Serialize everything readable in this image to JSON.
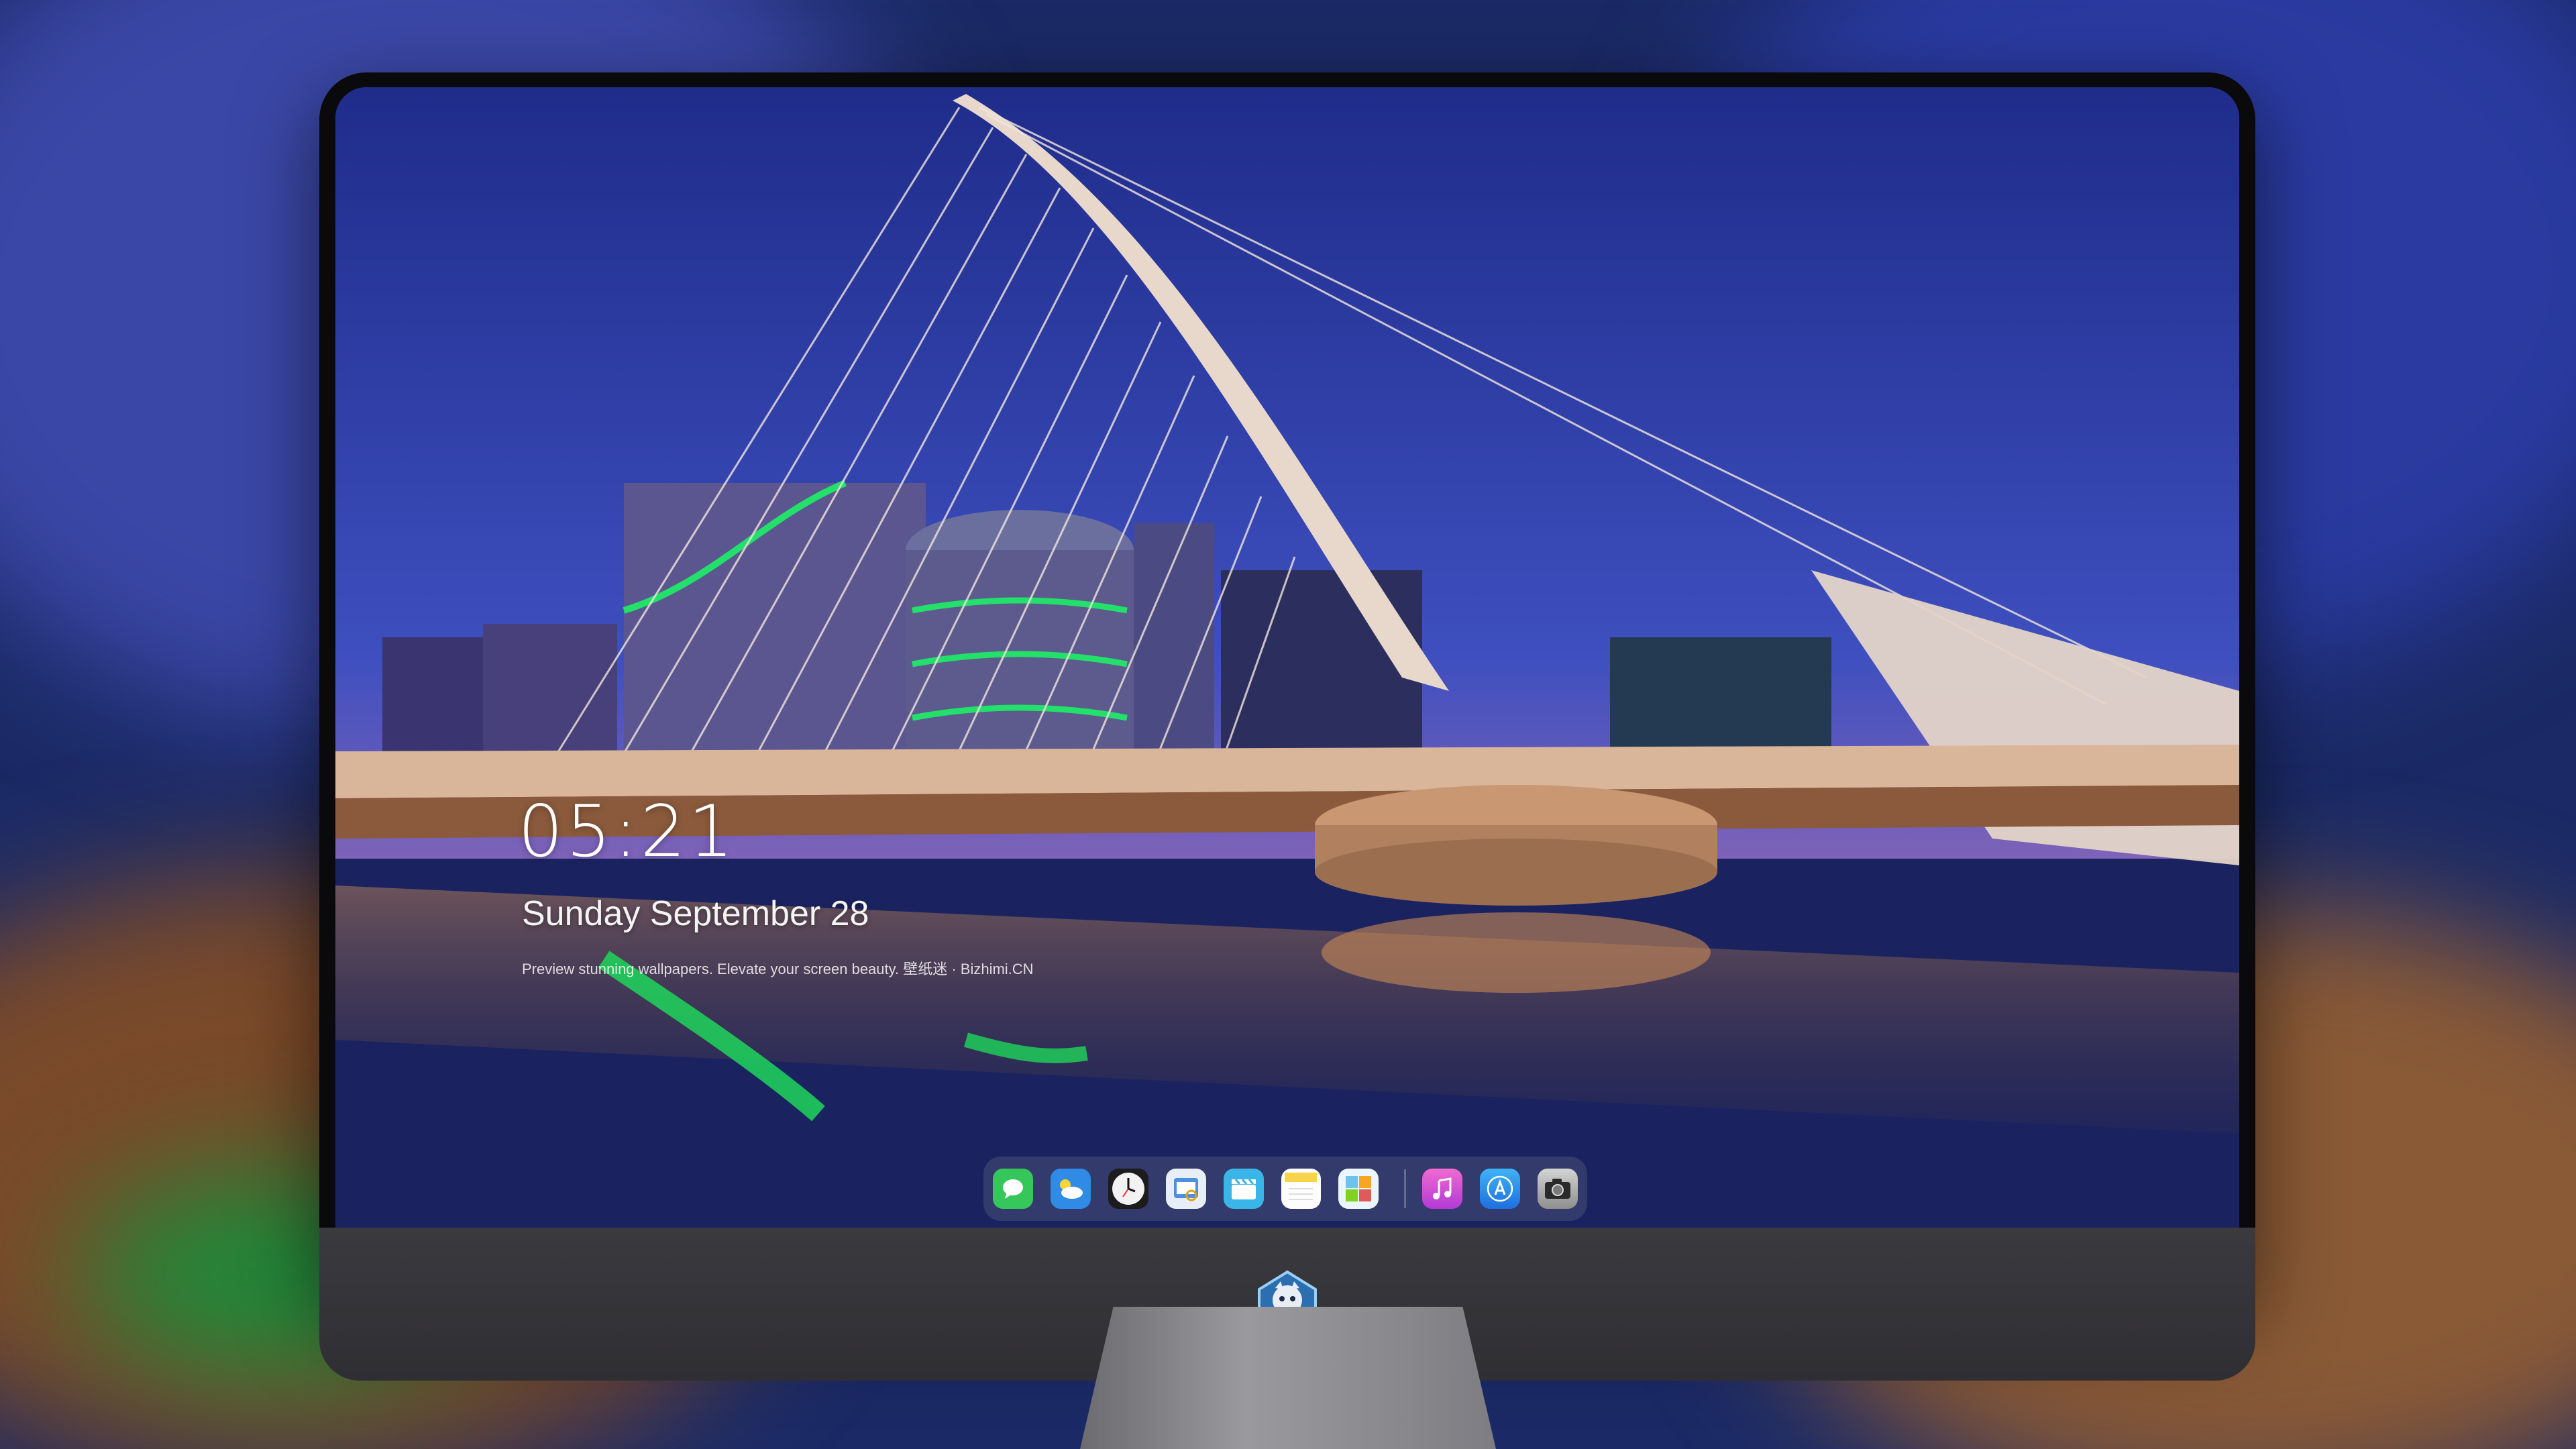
{
  "lock_screen": {
    "time": "05:21",
    "date": "Sunday September  28",
    "tagline": "Preview stunning wallpapers. Elevate your screen beauty. 壁纸迷 · Bizhimi.CN"
  },
  "dock": {
    "apps": [
      {
        "name": "messages-icon",
        "color": "#35c759"
      },
      {
        "name": "weather-icon",
        "color": "#2f8be6"
      },
      {
        "name": "clock-icon",
        "color": "#f2f2f2"
      },
      {
        "name": "preview-icon",
        "color": "#4d8fe0"
      },
      {
        "name": "clips-icon",
        "color": "#39b5e8"
      },
      {
        "name": "notes-icon",
        "color": "#f7d54a"
      },
      {
        "name": "photos-gallery-icon",
        "color": "#6fc1f0"
      },
      {
        "name": "music-icon",
        "color": "#d944d0"
      },
      {
        "name": "app-store-icon",
        "color": "#2d8cf0"
      },
      {
        "name": "camera-icon",
        "color": "#bdbdbd"
      }
    ]
  }
}
